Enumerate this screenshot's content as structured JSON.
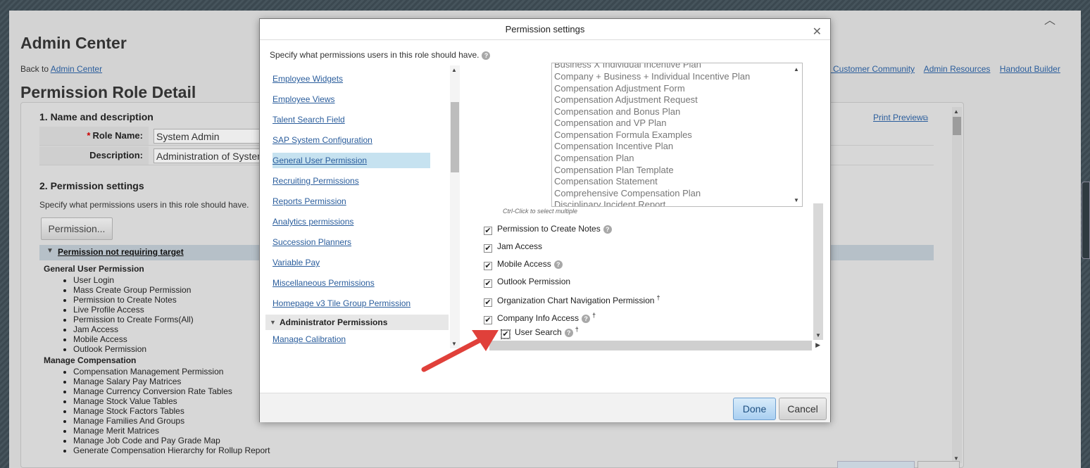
{
  "page": {
    "admin_title": "Admin Center",
    "back_prefix": "Back to",
    "back_link": "Admin Center",
    "top_links": [
      "o Customer Community",
      "Admin Resources",
      "Handout Builder"
    ],
    "role_detail_title": "Permission Role Detail",
    "print_preview": "Print Preview",
    "section1": "1. Name and description",
    "role_name_label": "Role Name:",
    "role_name_value": "System Admin",
    "description_label": "Description:",
    "description_value": "Administration of System",
    "section2": "2. Permission settings",
    "section2_desc": "Specify what permissions users in this role should have.",
    "permission_button": "Permission...",
    "not_requiring_target": "Permission not requiring target",
    "groups": [
      {
        "title": "General User Permission",
        "items": [
          "User Login",
          "Mass Create Group Permission",
          "Permission to Create Notes",
          "Live Profile Access",
          "Permission to Create Forms(All)",
          "Jam Access",
          "Mobile Access",
          "Outlook Permission"
        ]
      },
      {
        "title": "Manage Compensation",
        "items": [
          "Compensation Management Permission",
          "Manage Salary Pay Matrices",
          "Manage Currency Conversion Rate Tables",
          "Manage Stock Value Tables",
          "Manage Stock Factors Tables",
          "Manage Families And Groups",
          "Manage Merit Matrices",
          "Manage Job Code and Pay Grade Map",
          "Generate Compensation Hierarchy for Rollup Report"
        ]
      }
    ]
  },
  "modal": {
    "title": "Permission settings",
    "instructions": "Specify what permissions users in this role should have.",
    "categories": [
      {
        "label": "Employee Widgets",
        "selected": false
      },
      {
        "label": "Employee Views",
        "selected": false
      },
      {
        "label": "Talent Search Field",
        "selected": false
      },
      {
        "label": "SAP System Configuration",
        "selected": false
      },
      {
        "label": "General User Permission",
        "selected": true
      },
      {
        "label": "Recruiting Permissions",
        "selected": false
      },
      {
        "label": "Reports Permission",
        "selected": false
      },
      {
        "label": "Analytics permissions",
        "selected": false
      },
      {
        "label": "Succession Planners",
        "selected": false
      },
      {
        "label": "Variable Pay",
        "selected": false
      },
      {
        "label": "Miscellaneous Permissions",
        "selected": false
      },
      {
        "label": "Homepage v3 Tile Group Permission",
        "selected": false
      }
    ],
    "admin_header": "Administrator Permissions",
    "admin_first": "Manage Calibration",
    "form_templates": [
      "Business X Individual Incentive Plan",
      "Company + Business + Individual Incentive Plan",
      "Compensation Adjustment Form",
      "Compensation Adjustment Request",
      "Compensation and Bonus Plan",
      "Compensation and VP Plan",
      "Compensation Formula Examples",
      "Compensation Incentive Plan",
      "Compensation Plan",
      "Compensation Plan Template",
      "Compensation Statement",
      "Comprehensive Compensation Plan",
      "Disciplinary Incident Report"
    ],
    "ctrl_hint": "Ctrl-Click to select multiple",
    "checkboxes": [
      {
        "label": "Permission to Create Notes",
        "checked": true,
        "help": true,
        "dagger": false
      },
      {
        "label": "Jam Access",
        "checked": true,
        "help": false,
        "dagger": false
      },
      {
        "label": "Mobile Access",
        "checked": true,
        "help": true,
        "dagger": false
      },
      {
        "label": "Outlook Permission",
        "checked": true,
        "help": false,
        "dagger": false
      },
      {
        "label": "Organization Chart Navigation Permission",
        "checked": true,
        "help": false,
        "dagger": true
      },
      {
        "label": "Company Info Access",
        "checked": true,
        "help": true,
        "dagger": true
      }
    ],
    "sub_checkbox": {
      "label": "User Search",
      "checked": true,
      "dagger": true
    },
    "dagger_symbol": "†",
    "done": "Done",
    "cancel": "Cancel"
  },
  "colors": {
    "link": "#2a5d9c",
    "selected_category": "#c6e2f0",
    "annotation_arrow": "#e0403a"
  }
}
